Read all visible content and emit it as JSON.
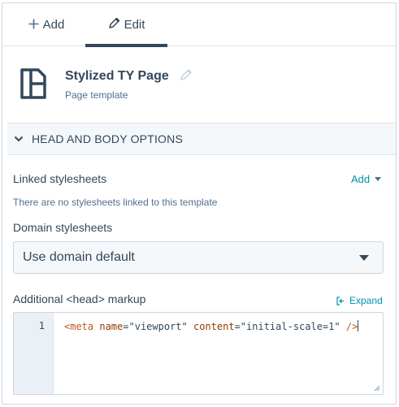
{
  "tabs": {
    "add_label": "Add",
    "edit_label": "Edit",
    "active": "edit"
  },
  "template": {
    "title": "Stylized TY Page",
    "subtitle": "Page template",
    "icon": "page-template-icon"
  },
  "section": {
    "label": "HEAD AND BODY OPTIONS",
    "expanded": true
  },
  "linked_stylesheets": {
    "label": "Linked stylesheets",
    "add_label": "Add",
    "empty_message": "There are no stylesheets linked to this template"
  },
  "domain_stylesheets": {
    "label": "Domain stylesheets",
    "selected": "Use domain default"
  },
  "head_markup": {
    "label": "Additional <head> markup",
    "expand_label": "Expand",
    "line_number": "1",
    "code_tag_open": "<meta",
    "code_attr1": "name",
    "code_eq1": "=",
    "code_val1": "\"viewport\"",
    "code_attr2": "content",
    "code_eq2": "=",
    "code_val2": "\"initial-scale=1\"",
    "code_close": "/>"
  },
  "colors": {
    "accent_link": "#0091ae",
    "text": "#33475b",
    "tag": "#c0541d"
  }
}
